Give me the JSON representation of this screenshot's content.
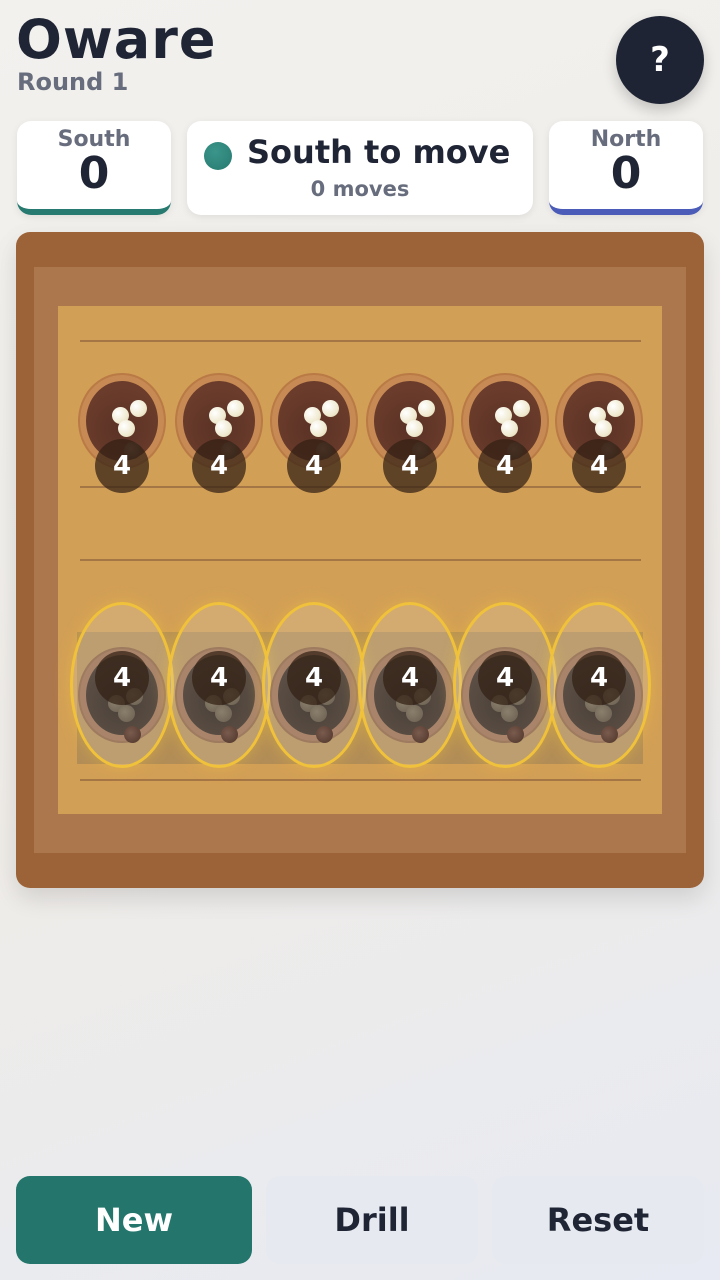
{
  "header": {
    "title": "Oware",
    "round": "Round 1",
    "help_label": "?"
  },
  "scores": {
    "south": {
      "label": "South",
      "value": "0",
      "color": "#277a70"
    },
    "north": {
      "label": "North",
      "value": "0",
      "color": "#4a5cb7"
    }
  },
  "status": {
    "turn": "South to move",
    "moves": "0 moves",
    "turn_color": "#277a70"
  },
  "board": {
    "north_pits": [
      {
        "count": "4"
      },
      {
        "count": "4"
      },
      {
        "count": "4"
      },
      {
        "count": "4"
      },
      {
        "count": "4"
      },
      {
        "count": "4"
      }
    ],
    "south_pits": [
      {
        "count": "4",
        "playable": true
      },
      {
        "count": "4",
        "playable": true
      },
      {
        "count": "4",
        "playable": true
      },
      {
        "count": "4",
        "playable": true
      },
      {
        "count": "4",
        "playable": true
      },
      {
        "count": "4",
        "playable": true
      }
    ],
    "highlight_color": "#f0c13b"
  },
  "controls": {
    "new_label": "New",
    "drill_label": "Drill",
    "reset_label": "Reset"
  }
}
